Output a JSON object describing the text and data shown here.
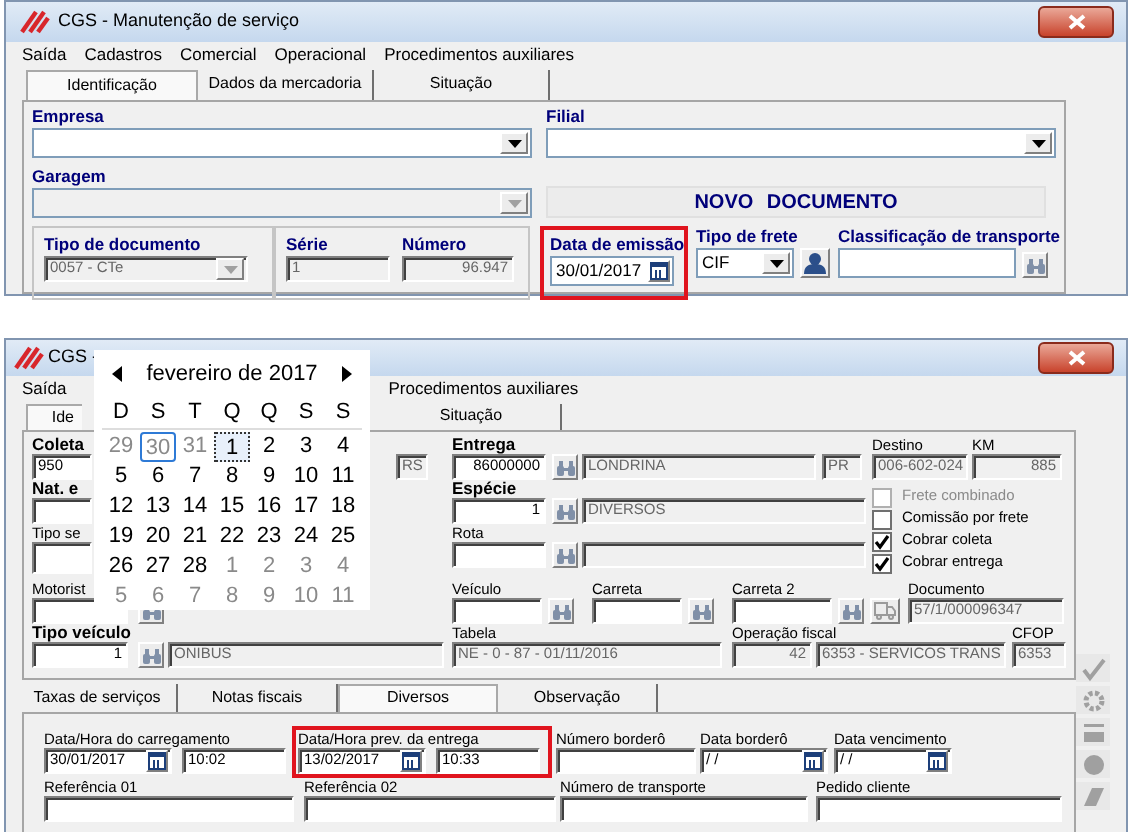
{
  "top_window": {
    "title": "CGS - Manutenção de serviço",
    "menu": [
      "Saída",
      "Cadastros",
      "Comercial",
      "Operacional",
      "Procedimentos auxiliares"
    ],
    "tabs": [
      {
        "label": "Identificação",
        "selected": true
      },
      {
        "label": "Dados da mercadoria",
        "selected": false
      },
      {
        "label": "Situação",
        "selected": false
      }
    ],
    "empresa": {
      "label": "Empresa"
    },
    "filial": {
      "label": "Filial"
    },
    "garagem": {
      "label": "Garagem",
      "disabled": true
    },
    "status_banner": "NOVO DOCUMENTO",
    "tipo_documento": {
      "label": "Tipo de documento",
      "value": "0057 - CTe",
      "disabled": true
    },
    "serie": {
      "label": "Série",
      "value": "1",
      "disabled": true
    },
    "numero": {
      "label": "Número",
      "value": "96.947",
      "disabled": true
    },
    "data_emissao": {
      "label": "Data de emissão",
      "value": "30/01/2017",
      "highlighted": true
    },
    "tipo_frete": {
      "label": "Tipo de frete",
      "value": "CIF"
    },
    "classificacao": {
      "label": "Classificação de transporte"
    }
  },
  "bottom_window": {
    "title": "CGS -",
    "menu": [
      "Saída",
      "Procedimentos auxiliares"
    ],
    "tabs": [
      {
        "label": "Ide",
        "selected": true
      },
      {
        "label": "Situação",
        "selected": false
      }
    ],
    "calendar": {
      "month": "fevereiro de 2017",
      "weekdays": [
        "D",
        "S",
        "T",
        "Q",
        "Q",
        "S",
        "S"
      ],
      "weeks": [
        [
          {
            "day": "29",
            "outside": true,
            "today": false,
            "selected": false
          },
          {
            "day": "30",
            "outside": true,
            "today": true,
            "selected": false
          },
          {
            "day": "31",
            "outside": true,
            "today": false,
            "selected": false
          },
          {
            "day": "1",
            "outside": false,
            "today": false,
            "selected": true
          },
          {
            "day": "2",
            "outside": false,
            "today": false,
            "selected": false
          },
          {
            "day": "3",
            "outside": false,
            "today": false,
            "selected": false
          },
          {
            "day": "4",
            "outside": false,
            "today": false,
            "selected": false
          }
        ],
        [
          {
            "day": "5",
            "outside": false,
            "today": false,
            "selected": false
          },
          {
            "day": "6",
            "outside": false,
            "today": false,
            "selected": false
          },
          {
            "day": "7",
            "outside": false,
            "today": false,
            "selected": false
          },
          {
            "day": "8",
            "outside": false,
            "today": false,
            "selected": false
          },
          {
            "day": "9",
            "outside": false,
            "today": false,
            "selected": false
          },
          {
            "day": "10",
            "outside": false,
            "today": false,
            "selected": false
          },
          {
            "day": "11",
            "outside": false,
            "today": false,
            "selected": false
          }
        ],
        [
          {
            "day": "12",
            "outside": false,
            "today": false,
            "selected": false
          },
          {
            "day": "13",
            "outside": false,
            "today": false,
            "selected": false
          },
          {
            "day": "14",
            "outside": false,
            "today": false,
            "selected": false
          },
          {
            "day": "15",
            "outside": false,
            "today": false,
            "selected": false
          },
          {
            "day": "16",
            "outside": false,
            "today": false,
            "selected": false
          },
          {
            "day": "17",
            "outside": false,
            "today": false,
            "selected": false
          },
          {
            "day": "18",
            "outside": false,
            "today": false,
            "selected": false
          }
        ],
        [
          {
            "day": "19",
            "outside": false,
            "today": false,
            "selected": false
          },
          {
            "day": "20",
            "outside": false,
            "today": false,
            "selected": false
          },
          {
            "day": "21",
            "outside": false,
            "today": false,
            "selected": false
          },
          {
            "day": "22",
            "outside": false,
            "today": false,
            "selected": false
          },
          {
            "day": "23",
            "outside": false,
            "today": false,
            "selected": false
          },
          {
            "day": "24",
            "outside": false,
            "today": false,
            "selected": false
          },
          {
            "day": "25",
            "outside": false,
            "today": false,
            "selected": false
          }
        ],
        [
          {
            "day": "26",
            "outside": false,
            "today": false,
            "selected": false
          },
          {
            "day": "27",
            "outside": false,
            "today": false,
            "selected": false
          },
          {
            "day": "28",
            "outside": false,
            "today": false,
            "selected": false
          },
          {
            "day": "1",
            "outside": true,
            "today": false,
            "selected": false
          },
          {
            "day": "2",
            "outside": true,
            "today": false,
            "selected": false
          },
          {
            "day": "3",
            "outside": true,
            "today": false,
            "selected": false
          },
          {
            "day": "4",
            "outside": true,
            "today": false,
            "selected": false
          }
        ],
        [
          {
            "day": "5",
            "outside": true,
            "today": false,
            "selected": false
          },
          {
            "day": "6",
            "outside": true,
            "today": false,
            "selected": false
          },
          {
            "day": "7",
            "outside": true,
            "today": false,
            "selected": false
          },
          {
            "day": "8",
            "outside": true,
            "today": false,
            "selected": false
          },
          {
            "day": "9",
            "outside": true,
            "today": false,
            "selected": false
          },
          {
            "day": "10",
            "outside": true,
            "today": false,
            "selected": false
          },
          {
            "day": "11",
            "outside": true,
            "today": false,
            "selected": false
          }
        ]
      ]
    },
    "coleta": {
      "label": "Coleta",
      "value": "950"
    },
    "uf_coleta": {
      "value": "RS"
    },
    "nat": {
      "label": "Nat. e"
    },
    "tipo_se": {
      "label": "Tipo se"
    },
    "entrega": {
      "label": "Entrega",
      "value": "86000000",
      "city": "LONDRINA",
      "uf": "PR"
    },
    "especie": {
      "label": "Espécie",
      "value": "1",
      "description": "DIVERSOS"
    },
    "rota": {
      "label": "Rota"
    },
    "destino": {
      "label": "Destino",
      "value": "006-602-024"
    },
    "km": {
      "label": "KM",
      "value": "885"
    },
    "options": [
      {
        "label": "Frete combinado",
        "checked": false,
        "disabled": true
      },
      {
        "label": "Comissão por frete",
        "checked": false,
        "disabled": false
      },
      {
        "label": "Cobrar coleta",
        "checked": true,
        "disabled": false
      },
      {
        "label": "Cobrar entrega",
        "checked": true,
        "disabled": false
      }
    ],
    "motorista": {
      "label": "Motorist"
    },
    "veiculo": {
      "label": "Veículo"
    },
    "carreta": {
      "label": "Carreta"
    },
    "carreta_2": {
      "label": "Carreta 2"
    },
    "documento": {
      "label": "Documento",
      "value": "57/1/000096347"
    },
    "tipo_veiculo": {
      "label": "Tipo veículo",
      "value": "1",
      "description": "ONIBUS"
    },
    "tabela": {
      "label": "Tabela",
      "value": "NE - 0 - 87 - 01/11/2016"
    },
    "operacao_fiscal": {
      "label": "Operação fiscal",
      "value": "42",
      "description": "6353 - SERVICOS TRANS"
    },
    "cfop": {
      "label": "CFOP",
      "value": "6353"
    },
    "lower_tabs": [
      {
        "label": "Taxas de serviços",
        "selected": false
      },
      {
        "label": "Notas fiscais",
        "selected": false
      },
      {
        "label": "Diversos",
        "selected": true
      },
      {
        "label": "Observação",
        "selected": false
      }
    ],
    "carregamento": {
      "label": "Data/Hora do carregamento",
      "date": "30/01/2017",
      "time": "10:02",
      "highlighted": false
    },
    "previsao_entrega": {
      "label": "Data/Hora prev. da entrega",
      "date": "13/02/2017",
      "time": "10:33",
      "highlighted": true
    },
    "numero_bordero": {
      "label": "Número borderô"
    },
    "data_bordero": {
      "label": "Data borderô",
      "date": " / /"
    },
    "data_vencimento": {
      "label": "Data vencimento",
      "date": " / /"
    },
    "referencia_01": {
      "label": "Referência 01"
    },
    "referencia_02": {
      "label": "Referência 02"
    },
    "numero_transporte": {
      "label": "Número de transporte"
    },
    "pedido_cliente": {
      "label": "Pedido cliente"
    }
  }
}
